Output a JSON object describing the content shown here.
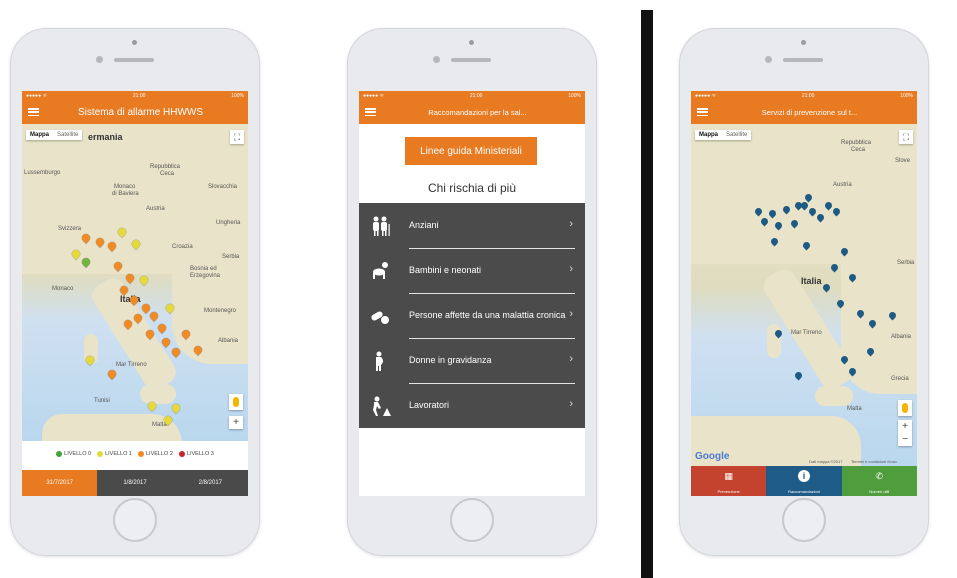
{
  "status": {
    "carrier": "●●●●● ᯤ",
    "time": "21:00",
    "battery": "100%"
  },
  "phone1": {
    "title": "Sistema di allarme HHWWS",
    "map_toggle": {
      "map": "Mappa",
      "satellite": "Satellite"
    },
    "labels": {
      "germania": "ermania",
      "lussemburgo": "Lussemburgo",
      "repubblica": "Repubblica",
      "ceca": "Ceca",
      "monaco_di_baviera": "Monaco",
      "di_baviera": "di Baviera",
      "austria": "Austria",
      "slovacchia": "Slovacchia",
      "ungheria": "Ungheria",
      "svizzera": "Svizzera",
      "croazia": "Croazia",
      "bosnia": "Bosnia ed",
      "erzegovina": "Erzegovina",
      "serbia": "Serbia",
      "italia": "Italia",
      "monaco": "Monaco",
      "montenegro": "Montenegro",
      "albania": "Albania",
      "tunisi": "Tunisi",
      "malta": "Malta",
      "mar_tirreno": "Mar Tirreno"
    },
    "legend": [
      {
        "label": "LIVELLO 0",
        "color": "#3fa535"
      },
      {
        "label": "LIVELLO 1",
        "color": "#e6d93a"
      },
      {
        "label": "LIVELLO 2",
        "color": "#f08a24"
      },
      {
        "label": "LIVELLO 3",
        "color": "#c9252c"
      }
    ],
    "dates": [
      "31/7/2017",
      "1/8/2017",
      "2/8/2017"
    ],
    "active_date_index": 0,
    "pin_colors": {
      "yellow": "#e6d93a",
      "orange": "#f08a24",
      "green": "#6fb53f"
    }
  },
  "phone2": {
    "title": "Raccomandazioni per la sal...",
    "ministerial_button": "Linee guida Ministeriali",
    "risk_heading": "Chi rischia di più",
    "risk_items": [
      {
        "label": "Anziani",
        "icon": "elderly-couple-icon"
      },
      {
        "label": "Bambini e neonati",
        "icon": "crawling-baby-icon"
      },
      {
        "label": "Persone affette da una malattia cronica",
        "icon": "pills-icon"
      },
      {
        "label": "Donne in gravidanza",
        "icon": "pregnant-woman-icon"
      },
      {
        "label": "Lavoratori",
        "icon": "worker-icon"
      }
    ]
  },
  "phone3": {
    "title": "Servizi di prevenzione sul t...",
    "map_toggle": {
      "map": "Mappa",
      "satellite": "Satellite"
    },
    "labels": {
      "repubblica": "Repubblica",
      "ceca": "Ceca",
      "austria": "Austria",
      "slovacchia": "Slove",
      "italia": "Italia",
      "mar_tirreno": "Mar Tirreno",
      "malta": "Malta",
      "serbia": "Serbia",
      "albania": "Albania",
      "grecia": "Grecia",
      "google": "Google",
      "map_credit": "Dati mappa ©2017",
      "terms": "Termini e condizioni d'uso"
    },
    "tabs": [
      {
        "label": "Prevenzione",
        "icon": "map-grid-icon"
      },
      {
        "label": "Raccomandazioni",
        "icon": "info-icon"
      },
      {
        "label": "Numeri utili",
        "icon": "phone-icon"
      }
    ],
    "pin_color": "#1d5a84"
  }
}
